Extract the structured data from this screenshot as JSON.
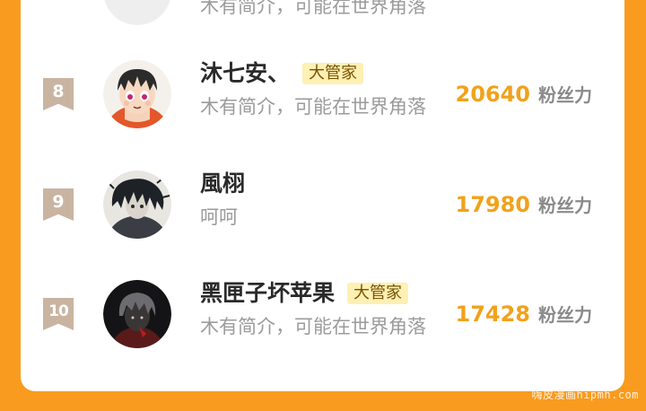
{
  "fans_unit": "粉丝力",
  "watermark": "嗨皮漫画hipmh.com",
  "ranking": [
    {
      "rank": "",
      "name": "",
      "badge": "",
      "bio": "木有简介，可能在世界角落",
      "fans": ""
    },
    {
      "rank": "8",
      "name": "沐七安、",
      "badge": "大管家",
      "bio": "木有简介，可能在世界角落",
      "fans": "20640"
    },
    {
      "rank": "9",
      "name": "風栩",
      "badge": "",
      "bio": "呵呵",
      "fans": "17980"
    },
    {
      "rank": "10",
      "name": "黑匣子坏苹果",
      "badge": "大管家",
      "bio": "木有简介，可能在世界角落",
      "fans": "17428"
    }
  ],
  "colors": {
    "background": "#f99b1f",
    "fans_count": "#f1a21b",
    "rank_badge": "#c9b4a2",
    "role_badge_bg": "#fff0b3"
  }
}
